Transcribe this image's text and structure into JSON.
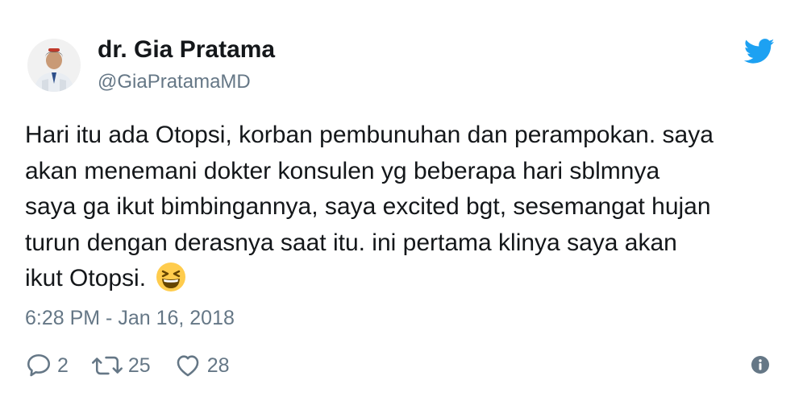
{
  "user": {
    "display_name": "dr. Gia Pratama",
    "handle": "@GiaPratamaMD"
  },
  "tweet": {
    "lines": [
      "Hari itu ada Otopsi, korban pembunuhan dan perampokan. saya",
      "akan menemani dokter konsulen yg beberapa hari sblmnya",
      "saya ga ikut bimbingannya, saya excited bgt, sesemangat hujan",
      "turun dengan derasnya saat itu. ini pertama klinya saya akan",
      "ikut Otopsi."
    ],
    "emoji": "grinning-squinting-face"
  },
  "timestamp": "6:28 PM - Jan 16, 2018",
  "actions": {
    "replies": "2",
    "retweets": "25",
    "likes": "28"
  },
  "icons": {
    "brand": "twitter-bird-icon",
    "reply": "reply-icon",
    "retweet": "retweet-icon",
    "like": "heart-icon",
    "info": "info-icon"
  },
  "colors": {
    "brand_blue": "#1da1f2",
    "text": "#14171a",
    "muted": "#657786"
  }
}
